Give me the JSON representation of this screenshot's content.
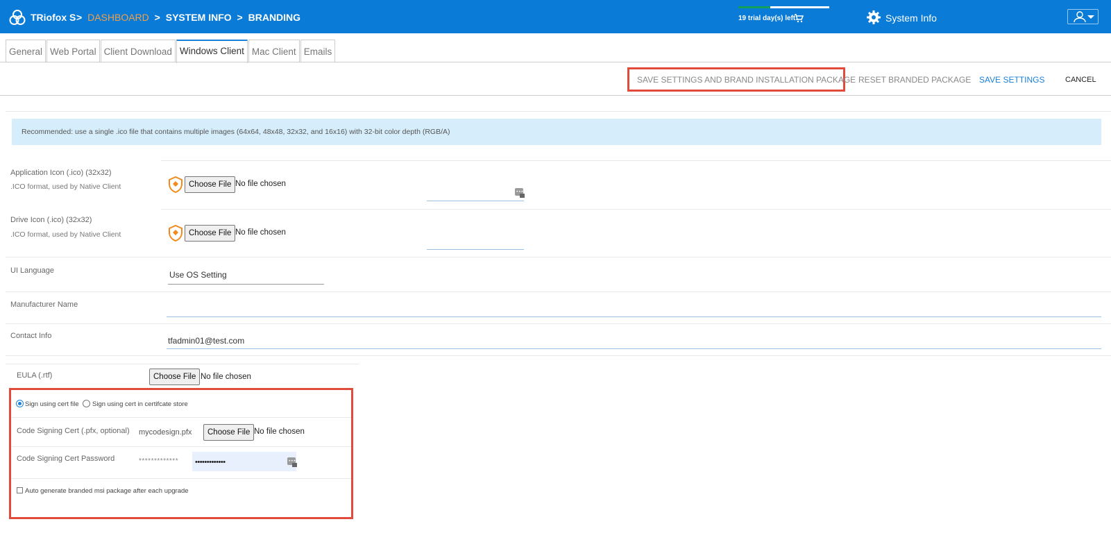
{
  "header": {
    "brand": "TRiofox S",
    "breadcrumb": [
      {
        "label": "DASHBOARD",
        "style": "link"
      },
      {
        "label": "SYSTEM INFO",
        "style": "normal"
      },
      {
        "label": "BRANDING",
        "style": "normal"
      }
    ],
    "separator": ">",
    "trial_text": "19 trial day(s) left.",
    "trial_progress_fraction": 0.35,
    "system_info_label": "System Info",
    "icons": [
      "logo-icon",
      "cart-icon",
      "gear-icon",
      "user-icon",
      "chevron-down-icon"
    ],
    "colors": {
      "bar": "#0a7bd6",
      "breadcrumb_link": "#f0a04a",
      "progress": "#12a05a"
    }
  },
  "tabs": [
    {
      "label": "General",
      "active": false
    },
    {
      "label": "Web Portal",
      "active": false
    },
    {
      "label": "Client Download",
      "active": false
    },
    {
      "label": "Windows Client",
      "active": true
    },
    {
      "label": "Mac Client",
      "active": false
    },
    {
      "label": "Emails",
      "active": false
    }
  ],
  "actions": {
    "save_brand": "SAVE SETTINGS AND BRAND INSTALLATION PACKAGE",
    "reset": "RESET BRANDED PACKAGE",
    "save": "SAVE SETTINGS",
    "cancel": "CANCEL",
    "highlight_color": "#e04b3c"
  },
  "banner": {
    "text": "Recommended: use a single .ico file that contains multiple images (64x64, 48x48, 32x32, and 16x16) with 32-bit color depth (RGB/A)"
  },
  "form": {
    "app_icon": {
      "label": "Application Icon (.ico) (32x32)",
      "sub": ".ICO format, used by Native Client",
      "button": "Choose File",
      "status": "No file chosen"
    },
    "drive_icon": {
      "label": "Drive Icon (.ico) (32x32)",
      "sub": ".ICO format, used by Native Client",
      "button": "Choose File",
      "status": "No file chosen"
    },
    "ui_language": {
      "label": "UI Language",
      "value": "Use OS Setting"
    },
    "manufacturer": {
      "label": "Manufacturer Name",
      "value": ""
    },
    "contact": {
      "label": "Contact Info",
      "value": "tfadmin01@test.com"
    },
    "eula": {
      "label": "EULA (.rtf)",
      "button": "Choose File",
      "status": "No file chosen"
    }
  },
  "signing": {
    "radio_file": "Sign using cert file",
    "radio_store": "Sign using cert in certifcate store",
    "selected": "file",
    "cert_label": "Code Signing Cert (.pfx, optional)",
    "cert_file": "mycodesign.pfx",
    "cert_button": "Choose File",
    "cert_status": "No file chosen",
    "password_label": "Code Signing Cert Password",
    "password_masked": "*************",
    "password_dots": "•••••••••••••",
    "auto_generate": "Auto generate branded msi package after each upgrade",
    "auto_generate_checked": false
  }
}
